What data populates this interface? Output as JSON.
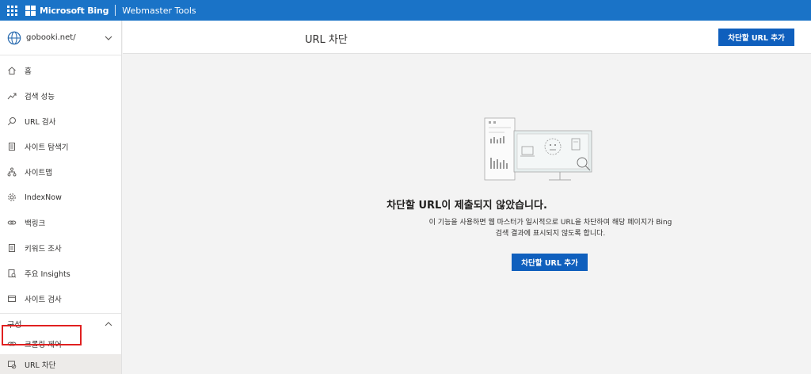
{
  "topbar": {
    "brand": "Microsoft Bing",
    "product": "Webmaster Tools"
  },
  "sidebar": {
    "site": "gobooki.net/",
    "items": [
      {
        "label": "홈",
        "icon": "home-icon"
      },
      {
        "label": "검색 성능",
        "icon": "trend-icon"
      },
      {
        "label": "URL 검사",
        "icon": "search-icon"
      },
      {
        "label": "사이트 탐색기",
        "icon": "document-icon"
      },
      {
        "label": "사이트맵",
        "icon": "sitemap-icon"
      },
      {
        "label": "IndexNow",
        "icon": "gear-icon"
      },
      {
        "label": "백링크",
        "icon": "link-icon"
      },
      {
        "label": "키워드 조사",
        "icon": "document-icon"
      },
      {
        "label": "주요 Insights",
        "icon": "insights-icon"
      },
      {
        "label": "사이트 검사",
        "icon": "scan-icon"
      }
    ],
    "section": {
      "label": "구성",
      "items": [
        {
          "label": "크롤링 제어",
          "icon": "link-icon"
        },
        {
          "label": "URL 차단",
          "icon": "block-url-icon",
          "active": true
        }
      ]
    }
  },
  "main": {
    "title": "URL 차단",
    "add_button": "차단할 URL 추가",
    "empty_title": "차단할 URL이 제출되지 않았습니다.",
    "empty_desc_line1": "이 기능을 사용하면 웹 마스터가 일시적으로 URL을 차단하여 해당 페이지가 Bing",
    "empty_desc_line2": "검색 결과에 표시되지 않도록 합니다.",
    "empty_button": "차단할 URL 추가"
  },
  "colors": {
    "topbar": "#1a73c7",
    "primary_button": "#0f5fbd",
    "highlight": "#e02020",
    "background": "#f3f3f3"
  }
}
